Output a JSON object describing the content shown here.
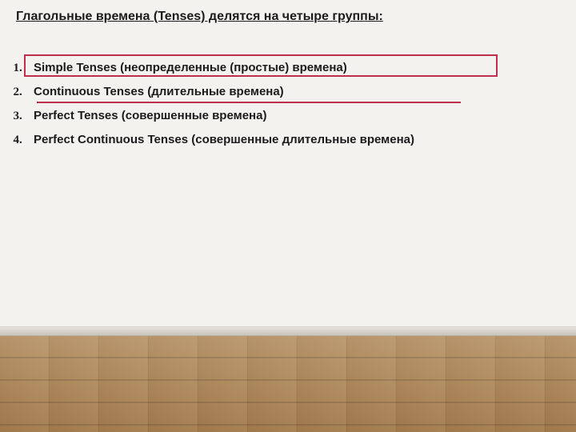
{
  "heading": "Глагольные времена (Tenses) делятся на четыре группы:",
  "items": [
    {
      "n": "1",
      "text": "Simple Tenses (неопределенные (простые) времена)"
    },
    {
      "n": "2",
      "text": "Continuous Tenses (длительные времена)"
    },
    {
      "n": "3",
      "text": "Perfect Tenses (совершенные времена)"
    },
    {
      "n": "4",
      "text": "Perfect Continuous Tenses (совершенные длительные времена)"
    }
  ]
}
